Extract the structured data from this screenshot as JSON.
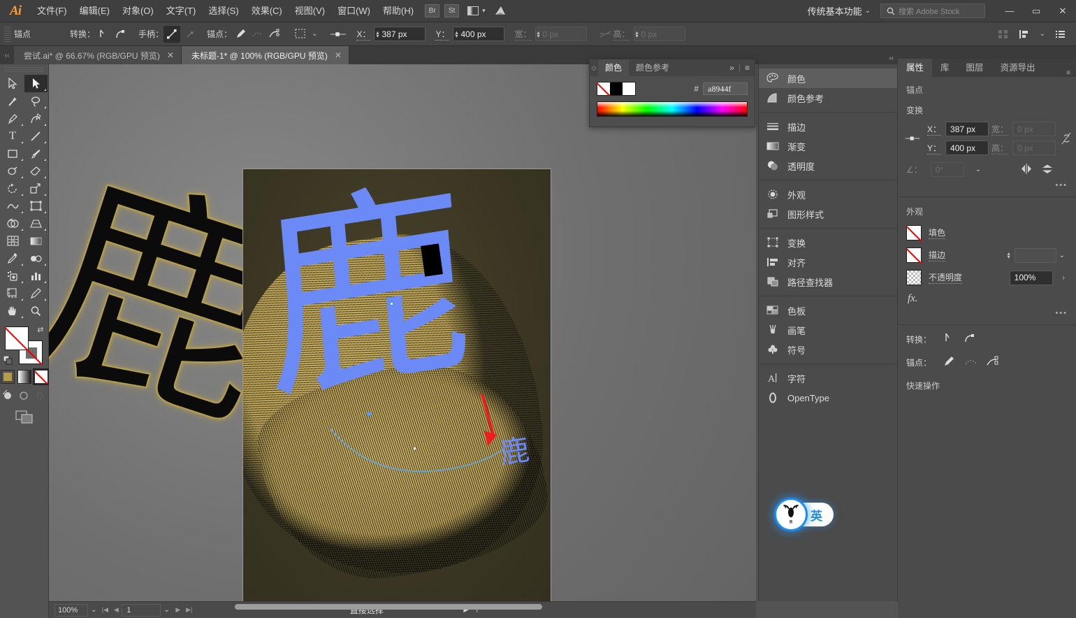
{
  "app": {
    "logo": "Ai",
    "menus": [
      "文件(F)",
      "编辑(E)",
      "对象(O)",
      "文字(T)",
      "选择(S)",
      "效果(C)",
      "视图(V)",
      "窗口(W)",
      "帮助(H)"
    ],
    "badges": [
      "Br",
      "St"
    ],
    "workspace": "传统基本功能",
    "search_placeholder": "搜索 Adobe Stock",
    "window_buttons": {
      "minimize": "—",
      "maximize": "▭",
      "close": "✕"
    }
  },
  "control_bar": {
    "context_label": "锚点",
    "convert_label": "转换：",
    "handles_label": "手柄：",
    "anchor_label": "锚点：",
    "x_label": "X：",
    "x_value": "387 px",
    "y_label": "Y：",
    "y_value": "400 px",
    "w_label": "宽：",
    "w_value": "0 px",
    "h_label": "高：",
    "h_value": "0 px"
  },
  "tabs": [
    {
      "title": "尝试.ai* @ 66.67% (RGB/GPU 预览)",
      "active": false,
      "close": "✕"
    },
    {
      "title": "未标题-1* @ 100% (RGB/GPU 预览)",
      "active": true,
      "close": "✕"
    }
  ],
  "toolbar": {
    "tools": [
      {
        "name": "selection-tool",
        "glyph": "▷"
      },
      {
        "name": "direct-selection-tool",
        "glyph": "▶",
        "active": true
      },
      {
        "name": "magic-wand-tool",
        "glyph": "✨"
      },
      {
        "name": "lasso-tool",
        "glyph": "🅠"
      },
      {
        "name": "pen-tool",
        "glyph": "✒"
      },
      {
        "name": "curvature-tool",
        "glyph": "✍"
      },
      {
        "name": "type-tool",
        "glyph": "T"
      },
      {
        "name": "line-segment-tool",
        "glyph": "╱"
      },
      {
        "name": "rectangle-tool",
        "glyph": "▭"
      },
      {
        "name": "paintbrush-tool",
        "glyph": "🖌"
      },
      {
        "name": "shaper-tool",
        "glyph": "◌"
      },
      {
        "name": "eraser-tool",
        "glyph": "◆"
      },
      {
        "name": "rotate-tool",
        "glyph": "↺"
      },
      {
        "name": "scale-tool",
        "glyph": "⤢"
      },
      {
        "name": "width-tool",
        "glyph": "∿"
      },
      {
        "name": "free-transform-tool",
        "glyph": "⬚"
      },
      {
        "name": "shape-builder-tool",
        "glyph": "◍"
      },
      {
        "name": "perspective-grid-tool",
        "glyph": "◩"
      },
      {
        "name": "mesh-tool",
        "glyph": "▦"
      },
      {
        "name": "gradient-tool",
        "glyph": "▬"
      },
      {
        "name": "eyedropper-tool",
        "glyph": "⚗"
      },
      {
        "name": "blend-tool",
        "glyph": "◑"
      },
      {
        "name": "symbol-sprayer-tool",
        "glyph": "⁙"
      },
      {
        "name": "column-graph-tool",
        "glyph": "▥"
      },
      {
        "name": "artboard-tool",
        "glyph": "⌗"
      },
      {
        "name": "slice-tool",
        "glyph": "✎"
      },
      {
        "name": "hand-tool",
        "glyph": "✋"
      },
      {
        "name": "zoom-tool",
        "glyph": "🔍"
      }
    ],
    "fill_state": "none",
    "stroke_state": "none",
    "color_modes": [
      "color",
      "gradient",
      "none"
    ],
    "selected_color_mode": "none"
  },
  "canvas": {
    "background_character": "鹿",
    "artboard": {
      "character": "鹿",
      "small_character": "鹿",
      "background_color": "#3b3724",
      "character_color": "#6b8af6",
      "blend_color": "#c0a85e",
      "arrow_color": "#ff2020"
    }
  },
  "color_panel": {
    "tabs": [
      {
        "label": "颜色",
        "active": true
      },
      {
        "label": "颜色参考",
        "active": false
      }
    ],
    "hash": "#",
    "hex_value": "a8944f",
    "collapse": "»",
    "menu": "≡"
  },
  "dock": {
    "groups": [
      [
        {
          "label": "颜色",
          "icon": "palette-icon",
          "glyph": "◕",
          "active": true
        },
        {
          "label": "颜色参考",
          "icon": "color-guide-icon",
          "glyph": "◔",
          "active": false
        }
      ],
      [
        {
          "label": "描边",
          "icon": "stroke-icon",
          "glyph": "≡",
          "active": false
        },
        {
          "label": "渐变",
          "icon": "gradient-icon",
          "glyph": "▤",
          "active": false
        },
        {
          "label": "透明度",
          "icon": "transparency-icon",
          "glyph": "◑",
          "active": false
        }
      ],
      [
        {
          "label": "外观",
          "icon": "appearance-icon",
          "glyph": "◉",
          "active": false
        },
        {
          "label": "图形样式",
          "icon": "graphic-styles-icon",
          "glyph": "❐",
          "active": false
        }
      ],
      [
        {
          "label": "变换",
          "icon": "transform-icon",
          "glyph": "⬚",
          "active": false
        },
        {
          "label": "对齐",
          "icon": "align-icon",
          "glyph": "▤",
          "active": false
        },
        {
          "label": "路径查找器",
          "icon": "pathfinder-icon",
          "glyph": "❏",
          "active": false
        }
      ],
      [
        {
          "label": "色板",
          "icon": "swatches-icon",
          "glyph": "▦",
          "active": false
        },
        {
          "label": "画笔",
          "icon": "brushes-icon",
          "glyph": "🖌",
          "active": false
        },
        {
          "label": "符号",
          "icon": "symbols-icon",
          "glyph": "♣",
          "active": false
        }
      ],
      [
        {
          "label": "字符",
          "icon": "character-icon",
          "glyph": "A",
          "active": false
        },
        {
          "label": "OpenType",
          "icon": "opentype-icon",
          "glyph": "O",
          "active": false
        }
      ]
    ]
  },
  "properties": {
    "tabs": [
      {
        "label": "属性",
        "active": true
      },
      {
        "label": "库",
        "active": false
      },
      {
        "label": "图层",
        "active": false
      },
      {
        "label": "资源导出",
        "active": false
      }
    ],
    "selection_label": "锚点",
    "transform": {
      "title": "变换",
      "x_label": "X：",
      "x_value": "387 px",
      "y_label": "Y：",
      "y_value": "400 px",
      "w_label": "宽：",
      "w_value": "0 px",
      "h_label": "高：",
      "h_value": "0 px",
      "angle_label": "∠：",
      "angle_value": "0°"
    },
    "appearance": {
      "title": "外观",
      "fill_label": "填色",
      "stroke_label": "描边",
      "opacity_label": "不透明度",
      "opacity_value": "100%",
      "fx_label": "fx."
    },
    "convert": {
      "label": "转换："
    },
    "anchor": {
      "label": "锚点："
    },
    "quick_actions": {
      "title": "快速操作"
    }
  },
  "status_bar": {
    "zoom": "100%",
    "page": "1",
    "tool": "直接选择"
  },
  "ime": {
    "mode": "英",
    "logo_text": "鹿"
  },
  "colors": {
    "accent": "#f59c3c",
    "chrome": "#535353",
    "panel": "#4b4b4b",
    "hex_swatch": "#a8944f",
    "artboard_blue": "#6b8af6",
    "artboard_bg": "#3b3724"
  }
}
